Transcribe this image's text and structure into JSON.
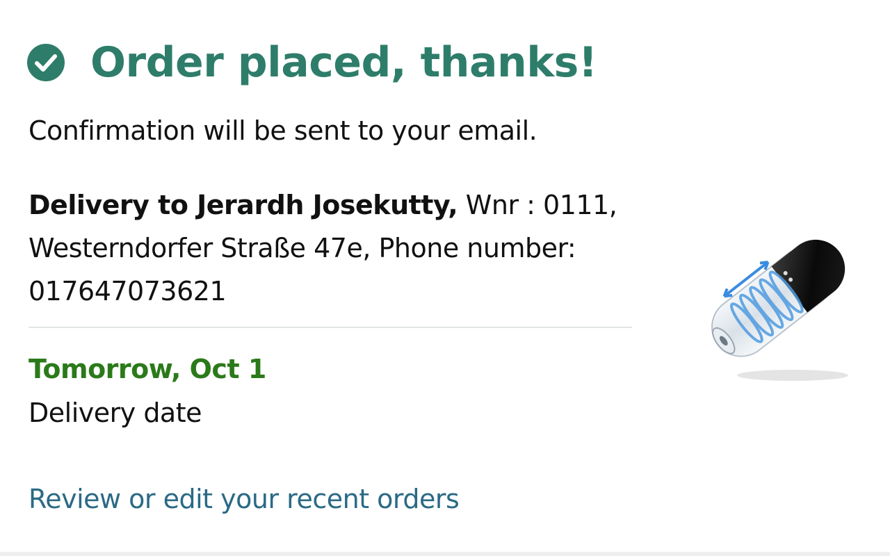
{
  "header": {
    "icon": "check-circle-icon",
    "title": "Order placed, thanks!",
    "accent_color": "#2e7d6a"
  },
  "confirmation_text": "Confirmation will be sent to your email.",
  "address": {
    "recipient": "Delivery to Jerardh Josekutty,",
    "details": " Wnr : 0111, Westerndorfer Straße 47e, Phone number: 017647073621"
  },
  "delivery": {
    "date": "Tomorrow, Oct 1",
    "label": "Delivery date",
    "date_color": "#2b7a1a"
  },
  "review_link": {
    "label": "Review or edit your recent orders",
    "color": "#2a6a85"
  },
  "product": {
    "image": "product-thumbnail"
  }
}
